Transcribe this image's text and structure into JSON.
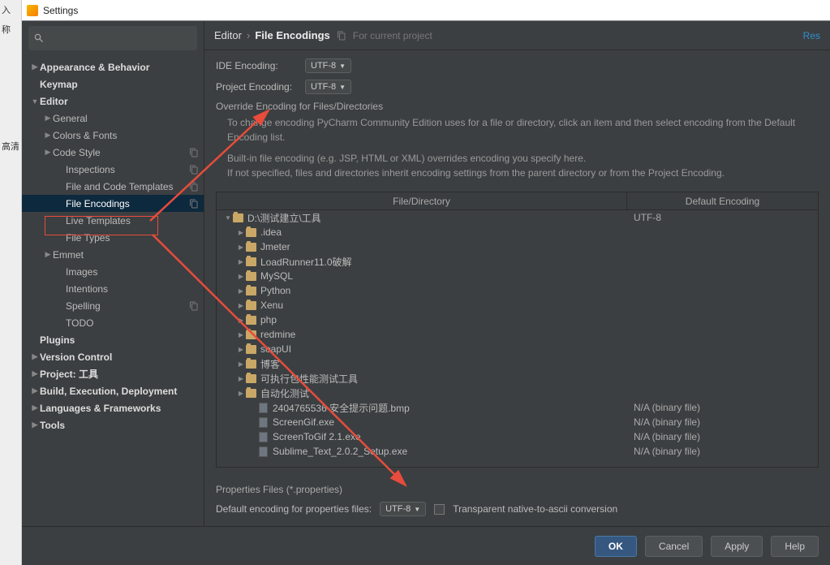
{
  "window": {
    "title": "Settings",
    "left_strip": [
      "入",
      "称",
      "高清"
    ]
  },
  "breadcrumb": {
    "parent": "Editor",
    "current": "File Encodings",
    "subtitle": "For current project",
    "reset": "Res"
  },
  "sidebar": {
    "items": [
      {
        "label": "Appearance & Behavior",
        "bold": true,
        "indent": 0,
        "arrow": "collapsed"
      },
      {
        "label": "Keymap",
        "bold": true,
        "indent": 0
      },
      {
        "label": "Editor",
        "bold": true,
        "indent": 0,
        "arrow": "expanded"
      },
      {
        "label": "General",
        "indent": 1,
        "arrow": "collapsed"
      },
      {
        "label": "Colors & Fonts",
        "indent": 1,
        "arrow": "collapsed"
      },
      {
        "label": "Code Style",
        "indent": 1,
        "arrow": "collapsed",
        "copy": true
      },
      {
        "label": "Inspections",
        "indent": 2,
        "copy": true
      },
      {
        "label": "File and Code Templates",
        "indent": 2,
        "copy": true
      },
      {
        "label": "File Encodings",
        "indent": 2,
        "selected": true,
        "copy": true
      },
      {
        "label": "Live Templates",
        "indent": 2
      },
      {
        "label": "File Types",
        "indent": 2
      },
      {
        "label": "Emmet",
        "indent": 1,
        "arrow": "collapsed"
      },
      {
        "label": "Images",
        "indent": 2
      },
      {
        "label": "Intentions",
        "indent": 2
      },
      {
        "label": "Spelling",
        "indent": 2,
        "copy": true
      },
      {
        "label": "TODO",
        "indent": 2
      },
      {
        "label": "Plugins",
        "bold": true,
        "indent": 0
      },
      {
        "label": "Version Control",
        "bold": true,
        "indent": 0,
        "arrow": "collapsed"
      },
      {
        "label": "Project: 工具",
        "bold": true,
        "indent": 0,
        "arrow": "collapsed"
      },
      {
        "label": "Build, Execution, Deployment",
        "bold": true,
        "indent": 0,
        "arrow": "collapsed"
      },
      {
        "label": "Languages & Frameworks",
        "bold": true,
        "indent": 0,
        "arrow": "collapsed"
      },
      {
        "label": "Tools",
        "bold": true,
        "indent": 0,
        "arrow": "collapsed"
      }
    ]
  },
  "form": {
    "ide_label": "IDE Encoding:",
    "ide_value": "UTF-8",
    "proj_label": "Project Encoding:",
    "proj_value": "UTF-8",
    "override_title": "Override Encoding for Files/Directories",
    "desc1": "To change encoding PyCharm Community Edition uses for a file or directory, click an item and then select encoding from the Default Encoding list.",
    "desc2a": "Built-in file encoding (e.g. JSP, HTML or XML) overrides encoding you specify here.",
    "desc2b": "If not specified, files and directories inherit encoding settings from the parent directory or from the Project Encoding."
  },
  "table": {
    "col_file": "File/Directory",
    "col_enc": "Default Encoding",
    "rows": [
      {
        "type": "folder",
        "indent": 0,
        "arrow": "expanded",
        "name": "D:\\测试建立\\工具",
        "enc": "UTF-8"
      },
      {
        "type": "folder",
        "indent": 1,
        "arrow": "collapsed",
        "name": ".idea"
      },
      {
        "type": "folder",
        "indent": 1,
        "arrow": "collapsed",
        "name": "Jmeter"
      },
      {
        "type": "folder",
        "indent": 1,
        "arrow": "collapsed",
        "name": "LoadRunner11.0破解"
      },
      {
        "type": "folder",
        "indent": 1,
        "arrow": "collapsed",
        "name": "MySQL"
      },
      {
        "type": "folder",
        "indent": 1,
        "arrow": "collapsed",
        "name": "Python"
      },
      {
        "type": "folder",
        "indent": 1,
        "arrow": "collapsed",
        "name": "Xenu"
      },
      {
        "type": "folder",
        "indent": 1,
        "arrow": "collapsed",
        "name": "php"
      },
      {
        "type": "folder",
        "indent": 1,
        "arrow": "collapsed",
        "name": "redmine"
      },
      {
        "type": "folder",
        "indent": 1,
        "arrow": "collapsed",
        "name": "soapUI"
      },
      {
        "type": "folder",
        "indent": 1,
        "arrow": "collapsed",
        "name": "博客"
      },
      {
        "type": "folder",
        "indent": 1,
        "arrow": "collapsed",
        "name": "可执行包性能测试工具"
      },
      {
        "type": "folder",
        "indent": 1,
        "arrow": "collapsed",
        "name": "自动化测试"
      },
      {
        "type": "file",
        "indent": 2,
        "name": "2404765536 安全提示问题.bmp",
        "enc": "N/A (binary file)"
      },
      {
        "type": "file",
        "indent": 2,
        "name": "ScreenGif.exe",
        "enc": "N/A (binary file)"
      },
      {
        "type": "file",
        "indent": 2,
        "name": "ScreenToGif 2.1.exe",
        "enc": "N/A (binary file)"
      },
      {
        "type": "file",
        "indent": 2,
        "name": "Sublime_Text_2.0.2_Setup.exe",
        "enc": "N/A (binary file)"
      }
    ]
  },
  "props": {
    "title": "Properties Files (*.properties)",
    "label": "Default encoding for properties files:",
    "value": "UTF-8",
    "chk_label": "Transparent native-to-ascii conversion"
  },
  "buttons": {
    "ok": "OK",
    "cancel": "Cancel",
    "apply": "Apply",
    "help": "Help"
  }
}
